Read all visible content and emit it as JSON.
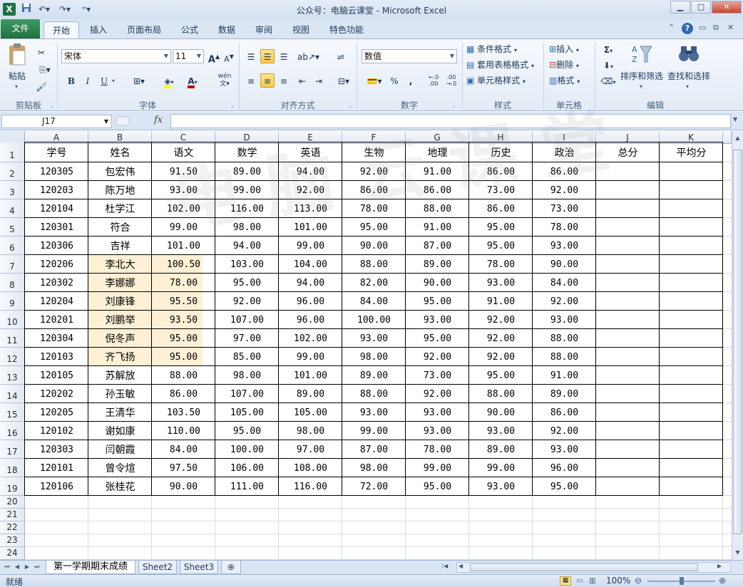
{
  "window": {
    "title": "公众号：电脑云课堂 - Microsoft Excel",
    "app_logo": "X",
    "quick_access": [
      "save-icon",
      "undo-icon",
      "redo-icon",
      "customize-icon"
    ]
  },
  "tabs": [
    "文件",
    "开始",
    "插入",
    "页面布局",
    "公式",
    "数据",
    "审阅",
    "视图",
    "特色功能"
  ],
  "ribbon": {
    "clipboard": {
      "paste": "粘贴",
      "label": "剪贴板"
    },
    "font": {
      "name": "宋体",
      "size": "11",
      "bold": "B",
      "italic": "I",
      "underline": "U",
      "grow": "A",
      "shrink": "A",
      "fill_color": "#ffff00",
      "font_color": "#c00000",
      "phonetic": "wén",
      "label": "字体"
    },
    "alignment": {
      "label": "对齐方式"
    },
    "number": {
      "format": "数值",
      "percent": "%",
      "comma": ",",
      "inc": "←.0 .00",
      "dec": ".00 →.0",
      "label": "数字"
    },
    "styles": {
      "conditional": "条件格式",
      "table": "套用表格格式",
      "cell_styles": "单元格样式",
      "label": "样式"
    },
    "cells": {
      "insert": "插入",
      "delete": "删除",
      "format": "格式",
      "label": "单元格"
    },
    "editing": {
      "sigma": "Σ",
      "sort": "排序和筛选",
      "find": "查找和选择",
      "label": "编辑"
    }
  },
  "formula_bar": {
    "name_box": "J17",
    "fx": "fx",
    "content": ""
  },
  "sheet": {
    "columns": [
      "A",
      "B",
      "C",
      "D",
      "E",
      "F",
      "G",
      "H",
      "I",
      "J",
      "K"
    ],
    "row_numbers": [
      "1",
      "2",
      "3",
      "4",
      "5",
      "6",
      "7",
      "8",
      "9",
      "10",
      "11",
      "12",
      "13",
      "14",
      "15",
      "16",
      "17",
      "18",
      "19",
      "20",
      "21",
      "22",
      "23",
      "24"
    ],
    "headers": [
      "学号",
      "姓名",
      "语文",
      "数学",
      "英语",
      "生物",
      "地理",
      "历史",
      "政治",
      "总分",
      "平均分"
    ],
    "rows": [
      [
        "120305",
        "包宏伟",
        "91.50",
        "89.00",
        "94.00",
        "92.00",
        "91.00",
        "86.00",
        "86.00"
      ],
      [
        "120203",
        "陈万地",
        "93.00",
        "99.00",
        "92.00",
        "86.00",
        "86.00",
        "73.00",
        "92.00"
      ],
      [
        "120104",
        "杜学江",
        "102.00",
        "116.00",
        "113.00",
        "78.00",
        "88.00",
        "86.00",
        "73.00"
      ],
      [
        "120301",
        "符合",
        "99.00",
        "98.00",
        "101.00",
        "95.00",
        "91.00",
        "95.00",
        "78.00"
      ],
      [
        "120306",
        "吉祥",
        "101.00",
        "94.00",
        "99.00",
        "90.00",
        "87.00",
        "95.00",
        "93.00"
      ],
      [
        "120206",
        "李北大",
        "100.50",
        "103.00",
        "104.00",
        "88.00",
        "89.00",
        "78.00",
        "90.00"
      ],
      [
        "120302",
        "李娜娜",
        "78.00",
        "95.00",
        "94.00",
        "82.00",
        "90.00",
        "93.00",
        "84.00"
      ],
      [
        "120204",
        "刘康锋",
        "95.50",
        "92.00",
        "96.00",
        "84.00",
        "95.00",
        "91.00",
        "92.00"
      ],
      [
        "120201",
        "刘鹏举",
        "93.50",
        "107.00",
        "96.00",
        "100.00",
        "93.00",
        "92.00",
        "93.00"
      ],
      [
        "120304",
        "倪冬声",
        "95.00",
        "97.00",
        "102.00",
        "93.00",
        "95.00",
        "92.00",
        "88.00"
      ],
      [
        "120103",
        "齐飞扬",
        "95.00",
        "85.00",
        "99.00",
        "98.00",
        "92.00",
        "92.00",
        "88.00"
      ],
      [
        "120105",
        "苏解放",
        "88.00",
        "98.00",
        "101.00",
        "89.00",
        "73.00",
        "95.00",
        "91.00"
      ],
      [
        "120202",
        "孙玉敏",
        "86.00",
        "107.00",
        "89.00",
        "88.00",
        "92.00",
        "88.00",
        "89.00"
      ],
      [
        "120205",
        "王清华",
        "103.50",
        "105.00",
        "105.00",
        "93.00",
        "93.00",
        "90.00",
        "86.00"
      ],
      [
        "120102",
        "谢如康",
        "110.00",
        "95.00",
        "98.00",
        "99.00",
        "93.00",
        "93.00",
        "92.00"
      ],
      [
        "120303",
        "闫朝霞",
        "84.00",
        "100.00",
        "97.00",
        "87.00",
        "78.00",
        "89.00",
        "93.00"
      ],
      [
        "120101",
        "曾令煊",
        "97.50",
        "106.00",
        "108.00",
        "98.00",
        "99.00",
        "99.00",
        "96.00"
      ],
      [
        "120106",
        "张桂花",
        "90.00",
        "111.00",
        "116.00",
        "72.00",
        "95.00",
        "93.00",
        "95.00"
      ]
    ],
    "highlight_color": "#fdf0d5",
    "watermark": "电脑云课堂"
  },
  "sheet_tabs": [
    "第一学期期末成绩",
    "Sheet2",
    "Sheet3"
  ],
  "status": {
    "ready": "就绪",
    "zoom": "100%"
  }
}
